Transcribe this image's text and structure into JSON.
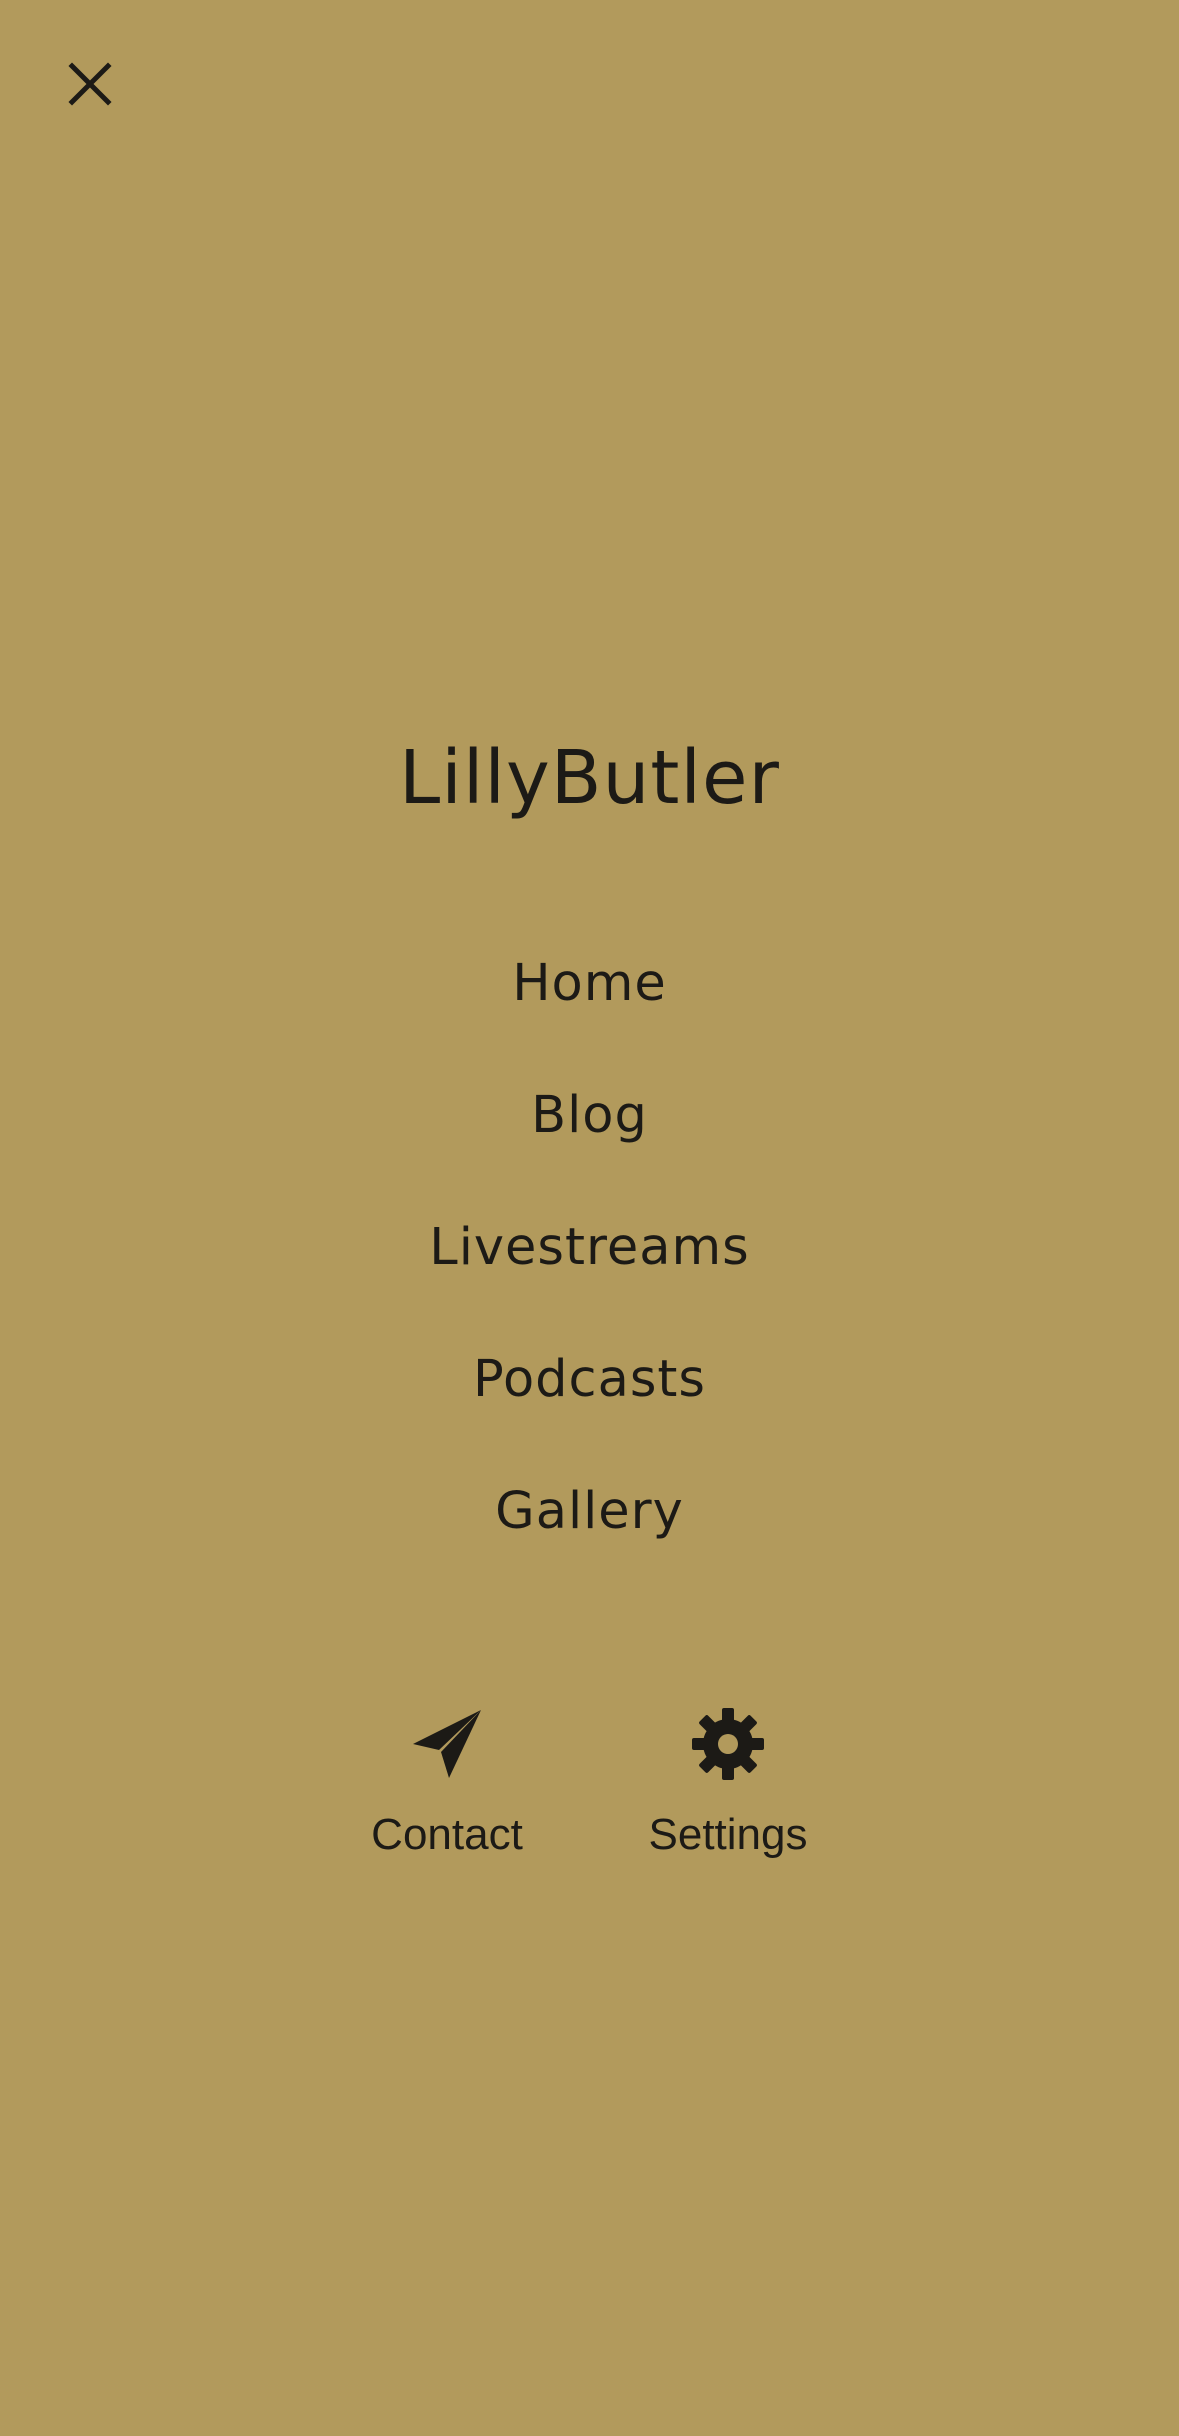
{
  "app": {
    "brand": "LillyButler",
    "background_color": "#b29a5c",
    "text_color": "#1c1a16"
  },
  "header": {
    "close_icon": "close-icon"
  },
  "nav": {
    "items": [
      {
        "label": "Home"
      },
      {
        "label": "Blog"
      },
      {
        "label": "Livestreams"
      },
      {
        "label": "Podcasts"
      },
      {
        "label": "Gallery"
      }
    ]
  },
  "actions": {
    "contact": {
      "label": "Contact",
      "icon": "paper-plane-icon"
    },
    "settings": {
      "label": "Settings",
      "icon": "gear-icon"
    }
  }
}
